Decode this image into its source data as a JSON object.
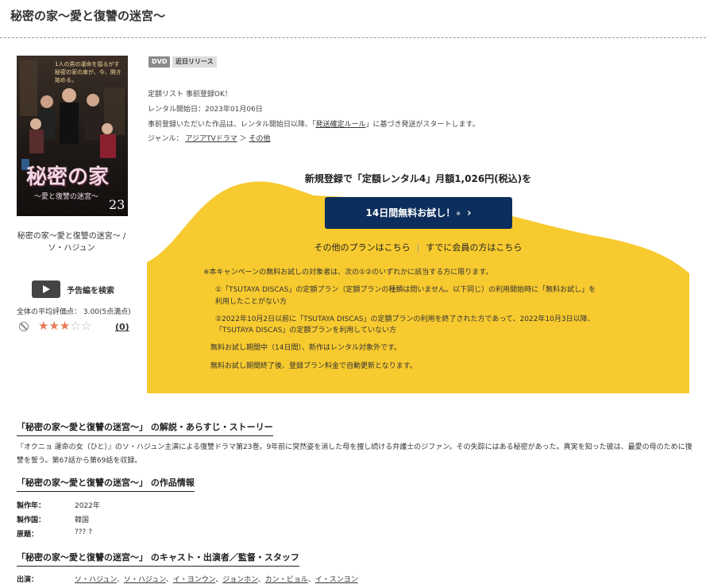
{
  "page_title": "秘密の家〜愛と復讐の迷宮〜",
  "poster": {
    "title_text": "秘密の家",
    "subtitle_text": "〜愛と復讐の迷宮〜",
    "volume": "23",
    "copy": "1人の男の運命を揺るがす秘密の家の扉が、今、開き始める。"
  },
  "caption": "秘密の家〜愛と復讐の迷宮〜 / ソ・ハジュン",
  "trailer_label": "予告編を検索",
  "average_rating_text": "全体の平均評価点： 3.00(5点満点)",
  "rating": {
    "value": 3,
    "max": 5
  },
  "review_count": "(0)",
  "badges": {
    "format": "DVD",
    "release": "近日リリース"
  },
  "info": {
    "line1": "定額リスト 事前登録OK！",
    "line2": "レンタル開始日：2023年01月06日",
    "line3_pre": "事前登録いただいた作品は、レンタル開始日以降、「",
    "line3_link": "発送確定ルール",
    "line3_post": "」に基づき発送がスタートします。",
    "genre_label": "ジャンル：",
    "genre1": "アジアTVドラマ",
    "genre_sep": "＞",
    "genre2": "その他"
  },
  "promo": {
    "headline": "新規登録で「定額レンタル4」月額1,026円(税込)を",
    "button_label": "14日間無料お試し！",
    "button_mark": "※",
    "button_chevron": "›",
    "other_plans": "その他のプランはこちら",
    "separator": "|",
    "members": "すでに会員の方はこちら",
    "notes": [
      "※本キャンペーンの無料お試しの対象者は、次の①②のいずれかに該当する方に限ります。",
      "①「TSUTAYA DISCAS」の定額プラン（定額プランの種類は問いません。以下同じ）の利用開始時に「無料お試し」を",
      "利用したことがない方",
      "②2022年10月2日以前に「TSUTAYA DISCAS」の定額プランの利用を終了された方であって、2022年10月3日以降、",
      "「TSUTAYA DISCAS」の定額プランを利用していない方",
      "無料お試し期間中（14日間）、新作はレンタル対象外です。",
      "無料お試し期間終了後、登録プラン料金で自動更新となります。"
    ]
  },
  "story": {
    "heading": "「秘密の家〜愛と復讐の迷宮〜」 の解説・あらすじ・ストーリー",
    "text": "『オクニョ 運命の女（ひと）』のソ・ハジュン主演による復讐ドラマ第23巻。9年前に突然姿を消した母を捜し続ける弁護士のジファン。その失踪にはある秘密があった。真実を知った彼は、最愛の母のために復讐を誓う。第67話から第69話を収録。"
  },
  "work_info": {
    "heading": "「秘密の家〜愛と復讐の迷宮〜」 の作品情報",
    "rows": [
      {
        "key": "製作年：",
        "value": "2022年"
      },
      {
        "key": "製作国：",
        "value": "韓国"
      },
      {
        "key": "原題：",
        "value": "??? ?"
      }
    ]
  },
  "cast_section": {
    "heading": "「秘密の家〜愛と復讐の迷宮〜」 のキャスト・出演者／監督・スタッフ",
    "label": "出演：",
    "names": [
      "ソ・ハジュン",
      "ソ・ハジュン",
      "イ・ヨンウン",
      "ジョンホン",
      "カン・ビョル",
      "イ・スンヨン"
    ],
    "delimiter": "、"
  },
  "colors": {
    "accent_yellow": "#f7ca2f",
    "button_navy": "#0c2e5c",
    "star": "#e87a55"
  }
}
